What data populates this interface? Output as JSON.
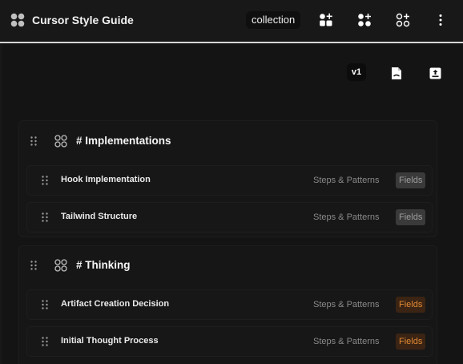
{
  "header": {
    "title": "Cursor Style Guide",
    "collection_label": "collection",
    "actions": [
      "add-item-icon",
      "add-group-icon",
      "add-grid-icon",
      "more-vertical-icon"
    ]
  },
  "toolbar": {
    "version": "v1",
    "icons": [
      "document-icon",
      "upload-icon"
    ]
  },
  "sections": [
    {
      "title": "# Implementations",
      "rows": [
        {
          "label": "Hook Implementation",
          "meta": "Steps & Patterns",
          "badge": "Fields",
          "badge_style": "grey"
        },
        {
          "label": "Tailwind Structure",
          "meta": "Steps & Patterns",
          "badge": "Fields",
          "badge_style": "grey"
        }
      ]
    },
    {
      "title": "# Thinking",
      "rows": [
        {
          "label": "Artifact Creation Decision",
          "meta": "Steps & Patterns",
          "badge": "Fields",
          "badge_style": "orange"
        },
        {
          "label": "Initial Thought Process",
          "meta": "Steps & Patterns",
          "badge": "Fields",
          "badge_style": "orange"
        }
      ]
    }
  ],
  "colors": {
    "background": "#141414",
    "accent_orange": "#e38a32",
    "badge_grey": "#3a3a3a",
    "separator": "#d6d6d6"
  }
}
